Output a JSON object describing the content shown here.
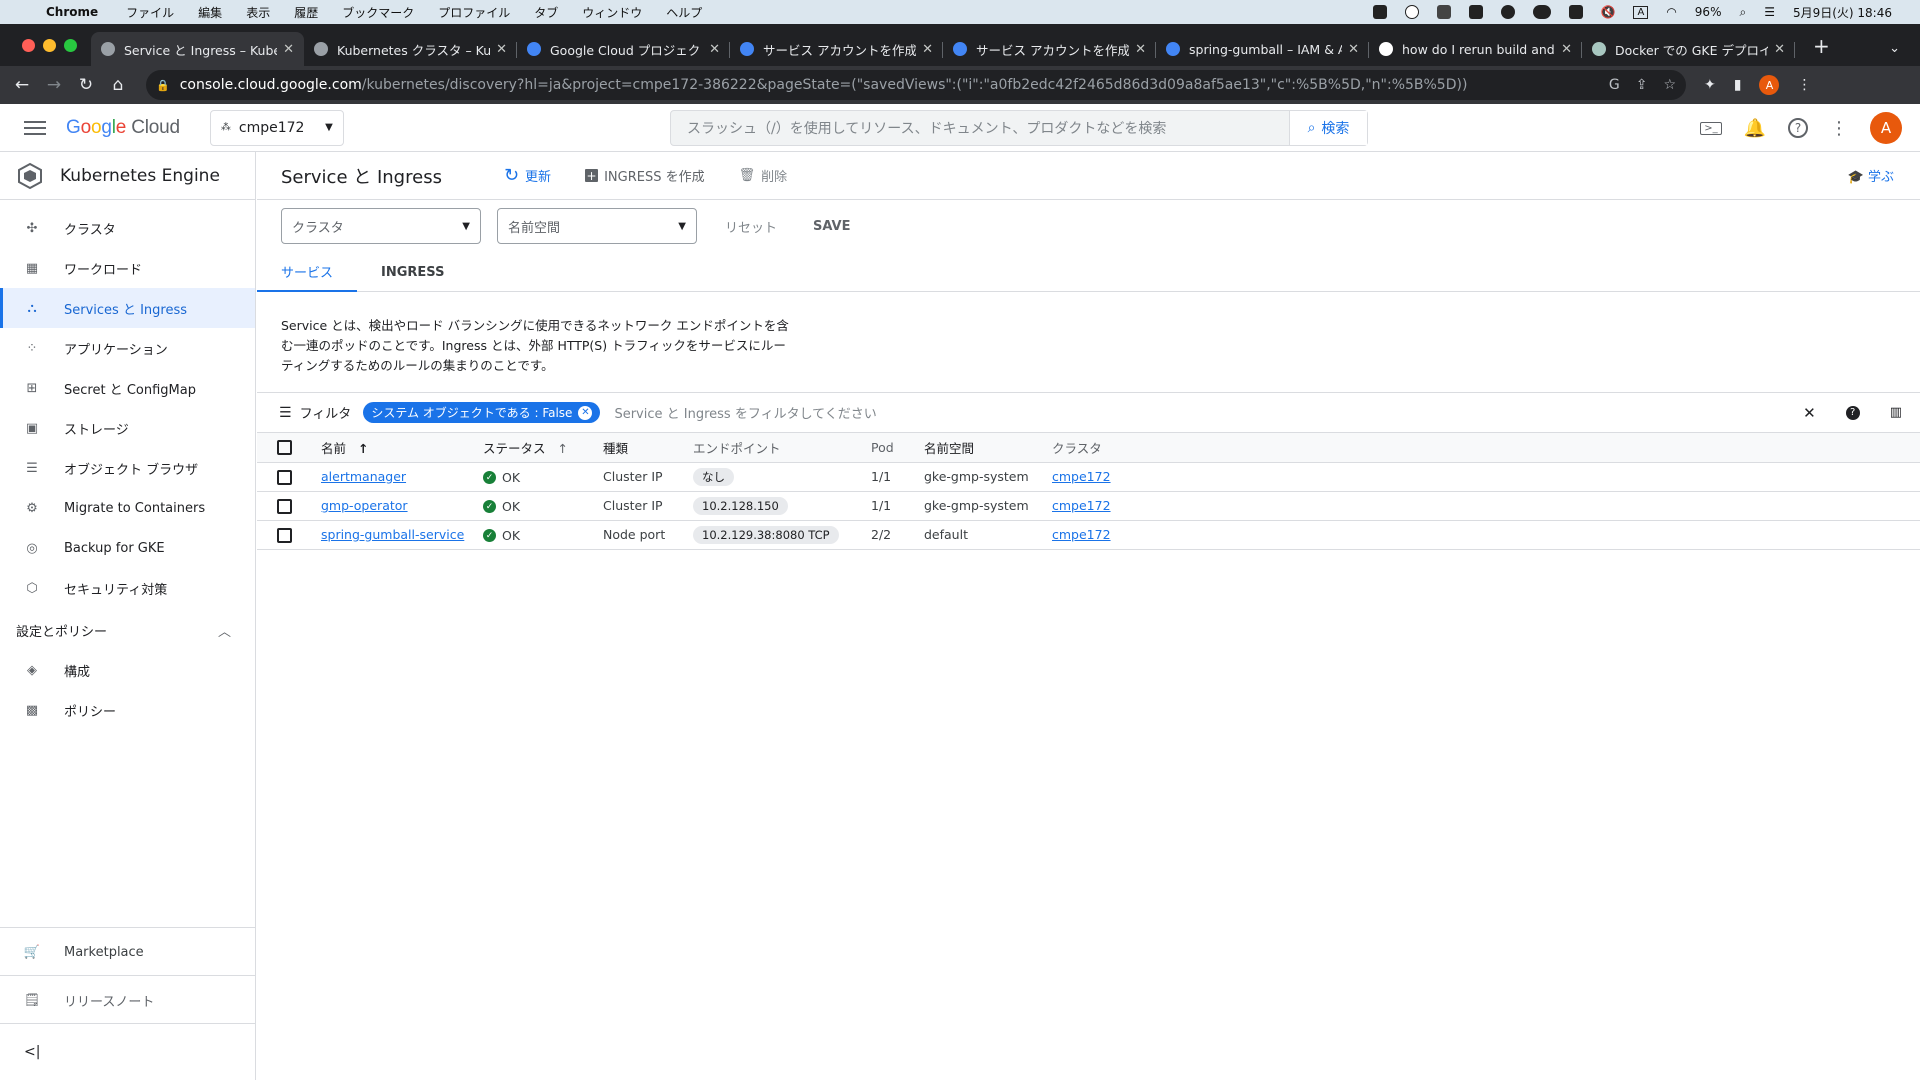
{
  "os": {
    "app_name": "Chrome",
    "menu": [
      "ファイル",
      "編集",
      "表示",
      "履歴",
      "ブックマーク",
      "プロファイル",
      "タブ",
      "ウィンドウ",
      "ヘルプ"
    ],
    "battery": "96%",
    "datetime": "5月9日(火)  18:46"
  },
  "browser": {
    "tabs": [
      {
        "title": "Service と Ingress – Kuber",
        "color": "#9aa0a6"
      },
      {
        "title": "Kubernetes クラスタ – Kub",
        "color": "#9aa0a6"
      },
      {
        "title": "Google Cloud プロジェクト",
        "color": "#4285f4"
      },
      {
        "title": "サービス アカウントを作成す",
        "color": "#4285f4"
      },
      {
        "title": "サービス アカウントを作成す",
        "color": "#4285f4"
      },
      {
        "title": "spring-gumball – IAM & Ad",
        "color": "#4285f4"
      },
      {
        "title": "how do I rerun build and d",
        "color": "#ffffff"
      },
      {
        "title": "Docker での GKE デプロイの",
        "color": "#a8c7c0"
      }
    ],
    "url_host": "console.cloud.google.com",
    "url_path": "/kubernetes/discovery?hl=ja&project=cmpe172-386222&pageState=(\"savedViews\":(\"i\":\"a0fb2edc42f2465d86d3d09a8af5ae13\",\"c\":%5B%5D,\"n\":%5B%5D))",
    "profile_initial": "A"
  },
  "header": {
    "logo": "Google Cloud",
    "project": "cmpe172",
    "search_placeholder": "スラッシュ（/）を使用してリソース、ドキュメント、プロダクトなどを検索",
    "search_button": "検索",
    "avatar_initial": "A"
  },
  "sidebar": {
    "title": "Kubernetes Engine",
    "items": [
      {
        "label": "クラスタ",
        "icon": "cluster-icon"
      },
      {
        "label": "ワークロード",
        "icon": "workload-icon"
      },
      {
        "label": "Services と Ingress",
        "icon": "services-icon"
      },
      {
        "label": "アプリケーション",
        "icon": "apps-icon"
      },
      {
        "label": "Secret と ConfigMap",
        "icon": "secret-icon"
      },
      {
        "label": "ストレージ",
        "icon": "storage-icon"
      },
      {
        "label": "オブジェクト ブラウザ",
        "icon": "object-browser-icon"
      },
      {
        "label": "Migrate to Containers",
        "icon": "migrate-icon"
      },
      {
        "label": "Backup for GKE",
        "icon": "backup-icon"
      },
      {
        "label": "セキュリティ対策",
        "icon": "security-icon"
      }
    ],
    "section_title": "設定とポリシー",
    "section_items": [
      {
        "label": "構成",
        "icon": "config-icon"
      },
      {
        "label": "ポリシー",
        "icon": "policy-icon"
      }
    ],
    "marketplace": "Marketplace",
    "release_notes": "リリースノート"
  },
  "main": {
    "page_title": "Service と Ingress",
    "refresh": "更新",
    "create_ingress": "INGRESS を作成",
    "delete": "削除",
    "learn": "学ぶ",
    "cluster_select": "クラスタ",
    "namespace_select": "名前空間",
    "reset": "リセット",
    "save": "SAVE",
    "tabs": [
      "サービス",
      "INGRESS"
    ],
    "description": "Service とは、検出やロード バランシングに使用できるネットワーク エンドポイントを含む一連のポッドのことです。Ingress とは、外部 HTTP(S) トラフィックをサービスにルーティングするためのルールの集まりのことです。",
    "filter_label": "フィルタ",
    "filter_chip": "システム オブジェクトである : False",
    "filter_placeholder": "Service と Ingress をフィルタしてください",
    "table": {
      "headers": [
        "名前",
        "ステータス",
        "種類",
        "エンドポイント",
        "Pod",
        "名前空間",
        "クラスタ"
      ],
      "rows": [
        {
          "name": "alertmanager",
          "status": "OK",
          "type": "Cluster IP",
          "endpoint": "なし",
          "pods": "1/1",
          "namespace": "gke-gmp-system",
          "cluster": "cmpe172"
        },
        {
          "name": "gmp-operator",
          "status": "OK",
          "type": "Cluster IP",
          "endpoint": "10.2.128.150",
          "pods": "1/1",
          "namespace": "gke-gmp-system",
          "cluster": "cmpe172"
        },
        {
          "name": "spring-gumball-service",
          "status": "OK",
          "type": "Node port",
          "endpoint": "10.2.129.38:8080 TCP",
          "pods": "2/2",
          "namespace": "default",
          "cluster": "cmpe172"
        }
      ]
    }
  }
}
